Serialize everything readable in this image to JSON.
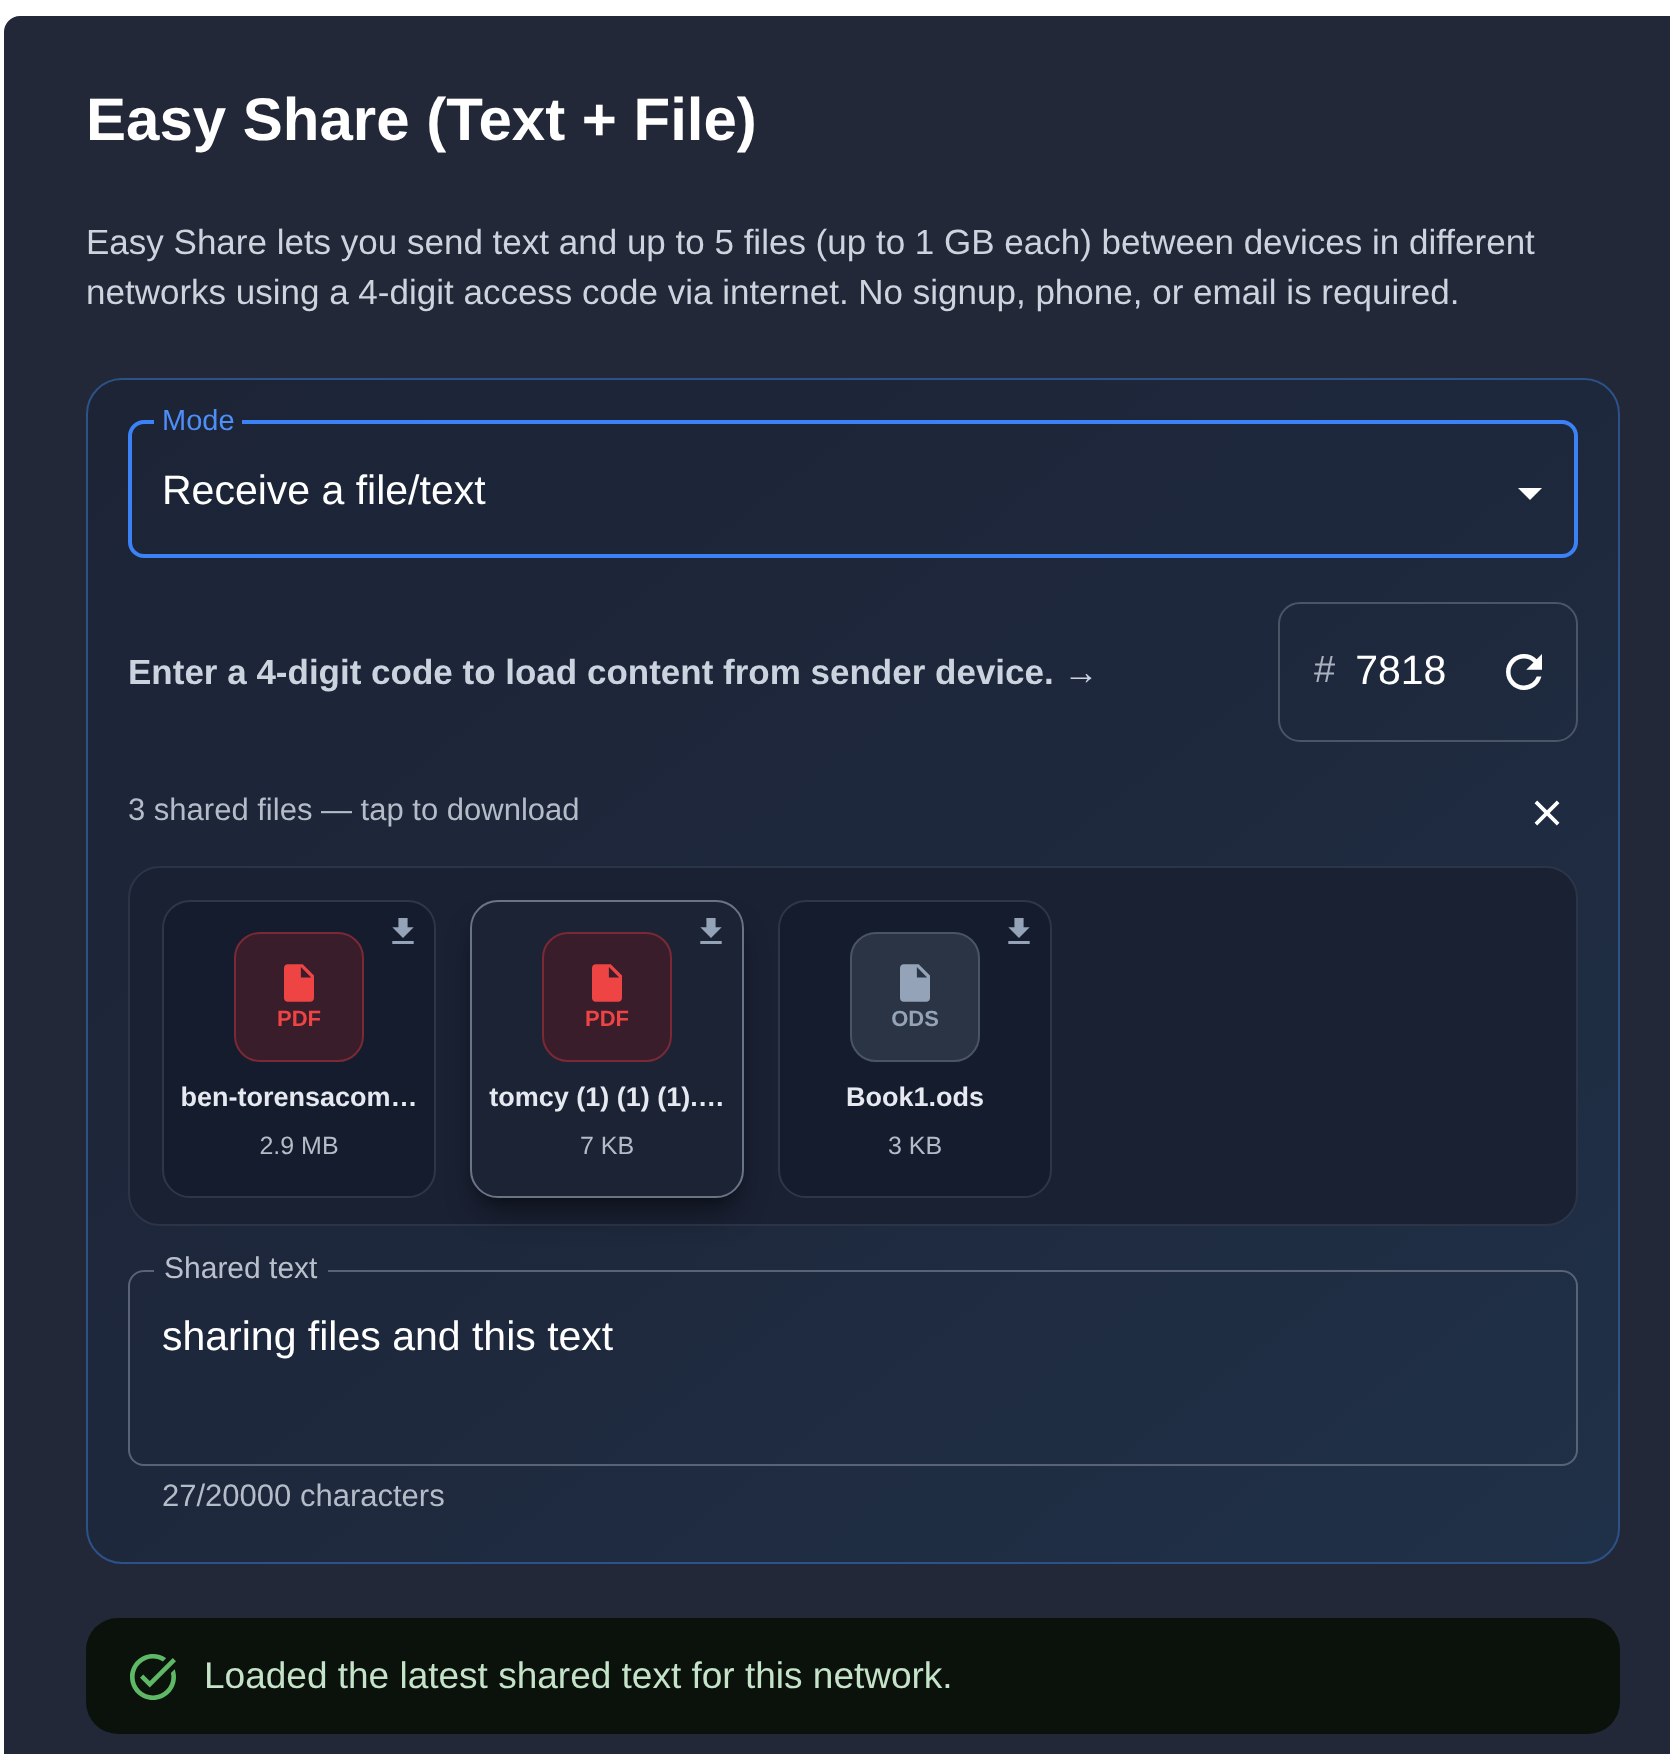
{
  "title": "Easy Share (Text + File)",
  "description": "Easy Share lets you send text and up to 5 files (up to 1 GB each) between devices in different networks using a 4-digit access code via internet. No signup, phone, or email is required.",
  "mode_select": {
    "label": "Mode",
    "value": "Receive a file/text",
    "focused": true
  },
  "code_entry": {
    "prompt": "Enter a 4-digit code to load content from sender device. →",
    "prefix": "#",
    "value": "7818"
  },
  "shared_files": {
    "summary": "3 shared files — tap to download",
    "files": [
      {
        "kind": "pdf",
        "type_label": "PDF",
        "name": "ben-torensacom…",
        "size": "2.9 MB",
        "selected": false
      },
      {
        "kind": "pdf",
        "type_label": "PDF",
        "name": "tomcy (1) (1) (1).…",
        "size": "7 KB",
        "selected": true
      },
      {
        "kind": "spreadsheet",
        "type_label": "ODS",
        "name": "Book1.ods",
        "size": "3 KB",
        "selected": false
      }
    ]
  },
  "shared_text": {
    "label": "Shared text",
    "value": "sharing files and this text",
    "counter": "27/20000 characters"
  },
  "alert": {
    "kind": "success",
    "message": "Loaded the latest shared text for this network."
  }
}
